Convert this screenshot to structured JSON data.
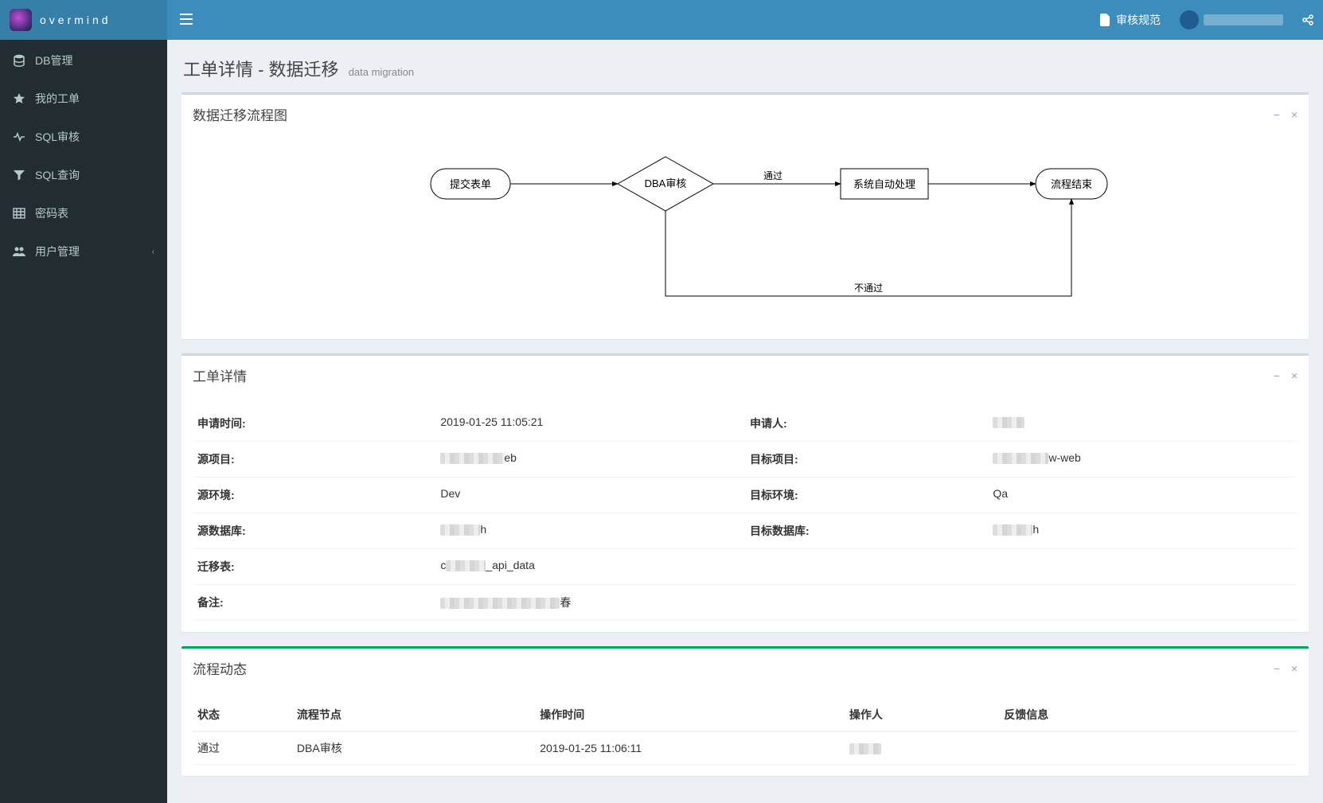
{
  "brand": "overmind",
  "topbar": {
    "audit_spec": "审核规范"
  },
  "sidebar": {
    "items": [
      {
        "icon": "database-icon",
        "label": "DB管理"
      },
      {
        "icon": "star-icon",
        "label": "我的工单"
      },
      {
        "icon": "heartbeat-icon",
        "label": "SQL审核"
      },
      {
        "icon": "filter-icon",
        "label": "SQL查询"
      },
      {
        "icon": "grid-icon",
        "label": "密码表"
      },
      {
        "icon": "users-icon",
        "label": "用户管理",
        "expandable": true
      }
    ]
  },
  "page": {
    "title": "工单详情 - 数据迁移",
    "subtitle": "data migration"
  },
  "flowchart": {
    "title": "数据迁移流程图",
    "nodes": {
      "submit": "提交表单",
      "dba": "DBA审核",
      "pass": "通过",
      "fail": "不通过",
      "auto": "系统自动处理",
      "end": "流程结束"
    }
  },
  "details": {
    "title": "工单详情",
    "rows": {
      "apply_time_label": "申请时间:",
      "apply_time_value": "2019-01-25 11:05:21",
      "applicant_label": "申请人:",
      "applicant_value_redacted": true,
      "src_project_label": "源项目:",
      "src_project_suffix": "eb",
      "dst_project_label": "目标项目:",
      "dst_project_suffix": "w-web",
      "src_env_label": "源环境:",
      "src_env_value": "Dev",
      "dst_env_label": "目标环境:",
      "dst_env_value": "Qa",
      "src_db_label": "源数据库:",
      "src_db_suffix": "h",
      "dst_db_label": "目标数据库:",
      "dst_db_suffix": "h",
      "mig_table_label": "迁移表:",
      "mig_table_prefix": "c",
      "mig_table_suffix": "_api_data",
      "remark_label": "备注:",
      "remark_suffix": "春"
    }
  },
  "timeline": {
    "title": "流程动态",
    "columns": [
      "状态",
      "流程节点",
      "操作时间",
      "操作人",
      "反馈信息"
    ],
    "rows": [
      {
        "status": "通过",
        "node": "DBA审核",
        "time": "2019-01-25 11:06:11",
        "operator_redacted": true,
        "feedback": ""
      }
    ]
  }
}
